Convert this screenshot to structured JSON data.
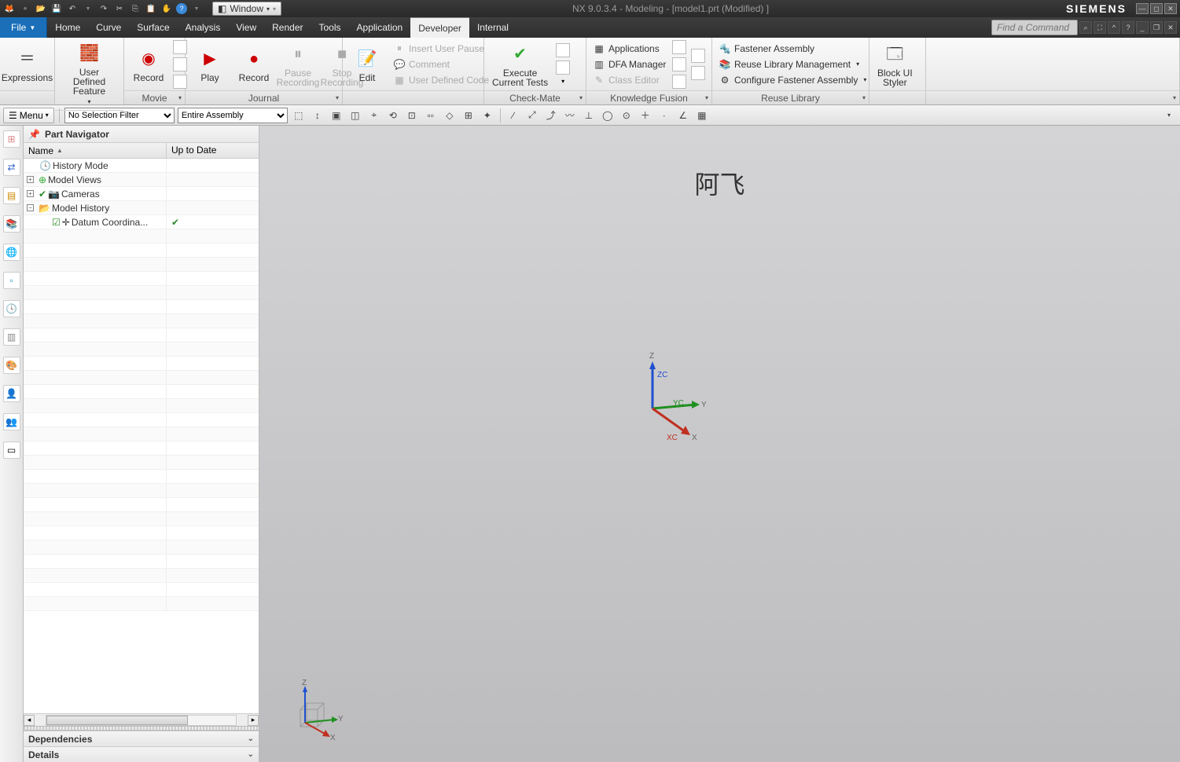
{
  "titlebar": {
    "window_menu": "Window",
    "title": "NX 9.0.3.4 - Modeling - [model1.prt (Modified) ]",
    "brand": "SIEMENS"
  },
  "menu_tabs": {
    "file": "File",
    "tabs": [
      "Home",
      "Curve",
      "Surface",
      "Analysis",
      "View",
      "Render",
      "Tools",
      "Application",
      "Developer",
      "Internal"
    ],
    "active_index": 8,
    "search_placeholder": "Find a Command"
  },
  "ribbon": {
    "expressions": "Expressions",
    "user_defined_feature": "User Defined\nFeature",
    "record": "Record",
    "play": "Play",
    "record2": "Record",
    "pause": "Pause\nRecording",
    "stop": "Stop\nRecording",
    "movie_group": "Movie",
    "edit": "Edit",
    "insert_user_pause": "Insert User Pause",
    "comment": "Comment",
    "user_defined_code": "User Defined Code",
    "journal_group": "Journal",
    "execute": "Execute\nCurrent Tests",
    "checkmate_group": "Check-Mate",
    "applications": "Applications",
    "dfa_manager": "DFA Manager",
    "class_editor": "Class Editor",
    "kf_group": "Knowledge Fusion",
    "fastener_assembly": "Fastener Assembly",
    "reuse_lib_mgmt": "Reuse Library Management",
    "config_fastener": "Configure Fastener Assembly",
    "reuse_group": "Reuse Library",
    "block_ui": "Block UI\nStyler"
  },
  "toolbar": {
    "menu": "Menu",
    "filter1": "No Selection Filter",
    "filter2": "Entire Assembly"
  },
  "navigator": {
    "title": "Part Navigator",
    "col_name": "Name",
    "col_uptodate": "Up to Date",
    "items": {
      "history_mode": "History Mode",
      "model_views": "Model Views",
      "cameras": "Cameras",
      "model_history": "Model History",
      "datum": "Datum Coordina..."
    },
    "dependencies": "Dependencies",
    "details": "Details"
  },
  "canvas": {
    "watermark": "阿飞",
    "axes": {
      "x": "X",
      "y": "Y",
      "z": "Z",
      "xc": "XC",
      "yc": "YC",
      "zc": "ZC"
    }
  }
}
